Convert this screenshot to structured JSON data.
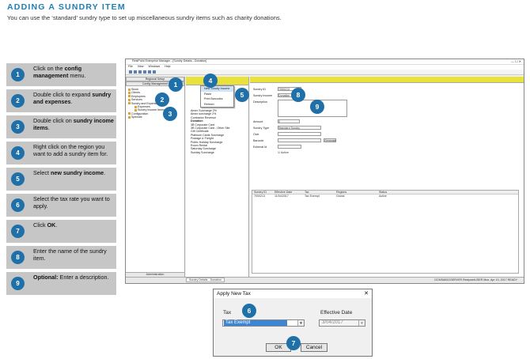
{
  "heading": "ADDING A SUNDRY ITEM",
  "intro": "You can use the ‘standard’ sundry type to set up miscellaneous sundry items such as charity donations.",
  "steps": [
    {
      "num": "1",
      "pre": "Click on the ",
      "bold": "config management",
      "post": " menu."
    },
    {
      "num": "2",
      "pre": "Double click to expand ",
      "bold": "sundry and expenses",
      "post": "."
    },
    {
      "num": "3",
      "pre": "Double click on ",
      "bold": "sundry income items",
      "post": "."
    },
    {
      "num": "4",
      "pre": "Right click on the region you want to add a sundry item for.",
      "bold": "",
      "post": ""
    },
    {
      "num": "5",
      "pre": "Select ",
      "bold": "new sundry income",
      "post": "."
    },
    {
      "num": "6",
      "pre": "Select the tax rate you want to apply.",
      "bold": "",
      "post": ""
    },
    {
      "num": "7",
      "pre": "Click ",
      "bold": "OK",
      "post": "."
    },
    {
      "num": "8",
      "pre": "Enter the name of the sundry item.",
      "bold": "",
      "post": ""
    },
    {
      "num": "9",
      "pre": "",
      "bold": "Optional:",
      "post": " Enter a description."
    }
  ],
  "app": {
    "title": "RestPoint Enterprise Manager - [Sundry Details - Donation]",
    "menu": [
      "File",
      "View",
      "Windows",
      "Help"
    ],
    "left_buttons": [
      "Regional Setup",
      "Config Management"
    ],
    "tree": [
      "Stock",
      "Clients",
      "Employees",
      "Services",
      "Sundry and Expense",
      "Expenses",
      "Sundry Income Items",
      "Configuration",
      "Specials"
    ],
    "admin_button": "Administration",
    "context_menu": [
      "New Sundry Income",
      "Paste",
      "Print Barcodes",
      "Refresh"
    ],
    "sundry_list": [
      "Amex Surcharge 2%",
      "Amex surcharge 2%",
      "Contractor Revenue",
      "Donation",
      "3B Corporate Card",
      "3B Corporate Card - Other Site",
      "Gift Certificate",
      "Platinum Cards Surcharge",
      "Postage & Freight",
      "Public Holiday Surcharge",
      "Room Rental",
      "Saturday Surcharge",
      "Sunday Surcharge"
    ],
    "form": {
      "labels": [
        "Sundry ID",
        "Sundry Income",
        "Description",
        "Amount",
        "Sundry Type",
        "Club",
        "Barcode",
        "External Id"
      ],
      "sundry_id": "7000213",
      "sundry_income": "Donation",
      "amount": "0",
      "sundry_type": "Standard Sundry",
      "generate": "Generate",
      "active": "Active"
    },
    "grid_headers": [
      "Sundry ID",
      "Effective Date",
      "Tax",
      "Regions",
      "Status"
    ],
    "grid_row": [
      "7000213",
      "11/04/2017",
      "Tax Exempt",
      "Global",
      "Active"
    ],
    "status_tab": "Sundry Details - Donation",
    "status_right": "DCMSABC0SERVER  RestpointUSER    Mon, Apr 10, 2017    READY"
  },
  "dialog": {
    "title": "Apply New Tax",
    "tax_label": "Tax",
    "tax_value": "Tax Exempt",
    "date_label": "Effective Date",
    "date_value": "3/04/2017",
    "ok": "OK",
    "cancel": "Cancel"
  },
  "callouts": [
    "1",
    "2",
    "3",
    "4",
    "5",
    "6",
    "7",
    "8",
    "9"
  ]
}
